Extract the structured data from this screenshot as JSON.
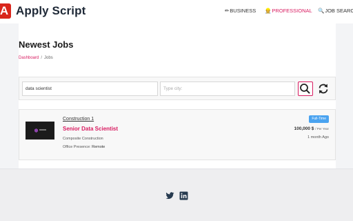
{
  "header": {
    "logo_letter": "A",
    "brand": "Apply Script",
    "nav": [
      {
        "icon": "briefcase-icon",
        "glyph": "✏",
        "label": "BUSINESS",
        "active": false
      },
      {
        "icon": "person-icon",
        "glyph": "👷",
        "label": "PROFESSIONAL",
        "active": true
      },
      {
        "icon": "search-icon",
        "glyph": "🔍",
        "label": "JOB SEARCH",
        "active": false
      }
    ]
  },
  "page": {
    "title": "Newest Jobs",
    "breadcrumb": {
      "link": "Dashboard",
      "separator": "/",
      "current": "Jobs"
    }
  },
  "search": {
    "keyword_value": "data scientist",
    "city_placeholder": "Type city:"
  },
  "job": {
    "company_link": "Construction 1",
    "title": "Senior Data Scientist",
    "company_name": "Composite Construction",
    "presence_label": "Office Presence:",
    "presence_value": "Remote",
    "badge": "Full-Time",
    "salary_amount": "100,000 $",
    "salary_unit": "/ Per Year",
    "posted": "1 month Ago"
  },
  "footer": {
    "social": [
      "twitter-icon",
      "linkedin-icon"
    ]
  },
  "colors": {
    "accent": "#d81b60",
    "logo": "#d9261c",
    "badge": "#4aa3f0"
  }
}
